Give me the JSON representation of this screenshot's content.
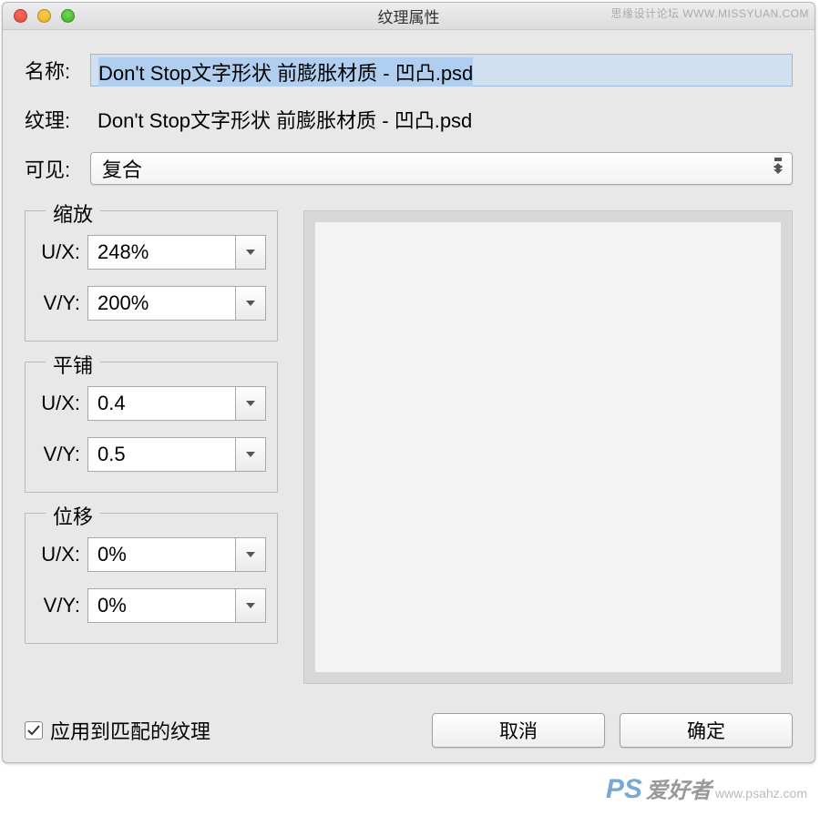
{
  "window": {
    "title": "纹理属性"
  },
  "fields": {
    "name_label": "名称:",
    "name_value": "Don't Stop文字形状 前膨胀材质 - 凹凸.psd",
    "texture_label": "纹理:",
    "texture_value": "Don't Stop文字形状 前膨胀材质 - 凹凸.psd",
    "visible_label": "可见:",
    "visible_value": "复合"
  },
  "scale": {
    "legend": "缩放",
    "ux_label": "U/X:",
    "ux_value": "248%",
    "vy_label": "V/Y:",
    "vy_value": "200%"
  },
  "tile": {
    "legend": "平铺",
    "ux_label": "U/X:",
    "ux_value": "0.4",
    "vy_label": "V/Y:",
    "vy_value": "0.5"
  },
  "offset": {
    "legend": "位移",
    "ux_label": "U/X:",
    "ux_value": "0%",
    "vy_label": "V/Y:",
    "vy_value": "0%"
  },
  "apply_label": "应用到匹配的纹理",
  "buttons": {
    "cancel": "取消",
    "ok": "确定"
  },
  "watermarks": {
    "top": "思缘设计论坛  WWW.MISSYUAN.COM",
    "bottom_brand": "PS",
    "bottom_text": "爱好者",
    "bottom_url": "www.psahz.com"
  }
}
